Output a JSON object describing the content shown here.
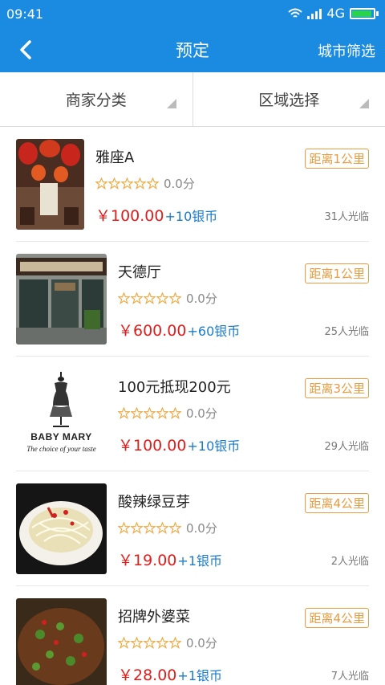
{
  "status": {
    "time": "09:41",
    "network": "4G"
  },
  "header": {
    "title": "预定",
    "right_action": "城市筛选"
  },
  "filters": {
    "category": "商家分类",
    "region": "区域选择"
  },
  "items": [
    {
      "name": "雅座A",
      "distance": "距离1公里",
      "rating": "0.0分",
      "price": "￥100.00",
      "bonus": "+10银币",
      "visits": "31人光临",
      "thumb": "lanterns"
    },
    {
      "name": "天德厅",
      "distance": "距离1公里",
      "rating": "0.0分",
      "price": "￥600.00",
      "bonus": "+60银币",
      "visits": "25人光临",
      "thumb": "storefront"
    },
    {
      "name": "100元抵现200元",
      "distance": "距离3公里",
      "rating": "0.0分",
      "price": "￥100.00",
      "bonus": "+10银币",
      "visits": "29人光临",
      "thumb": "brand",
      "brand_text": "BABY MARY",
      "brand_tagline": "The choice of your taste"
    },
    {
      "name": "酸辣绿豆芽",
      "distance": "距离4公里",
      "rating": "0.0分",
      "price": "￥19.00",
      "bonus": "+1银币",
      "visits": "2人光临",
      "thumb": "sprouts"
    },
    {
      "name": "招牌外婆菜",
      "distance": "距离4公里",
      "rating": "0.0分",
      "price": "￥28.00",
      "bonus": "+1银币",
      "visits": "7人光临",
      "thumb": "greens"
    }
  ],
  "colors": {
    "primary": "#1a8be0",
    "price": "#e31b1b",
    "bonus": "#1a7cc8",
    "distance": "#ee9a3e",
    "star": "#f3a63a"
  }
}
